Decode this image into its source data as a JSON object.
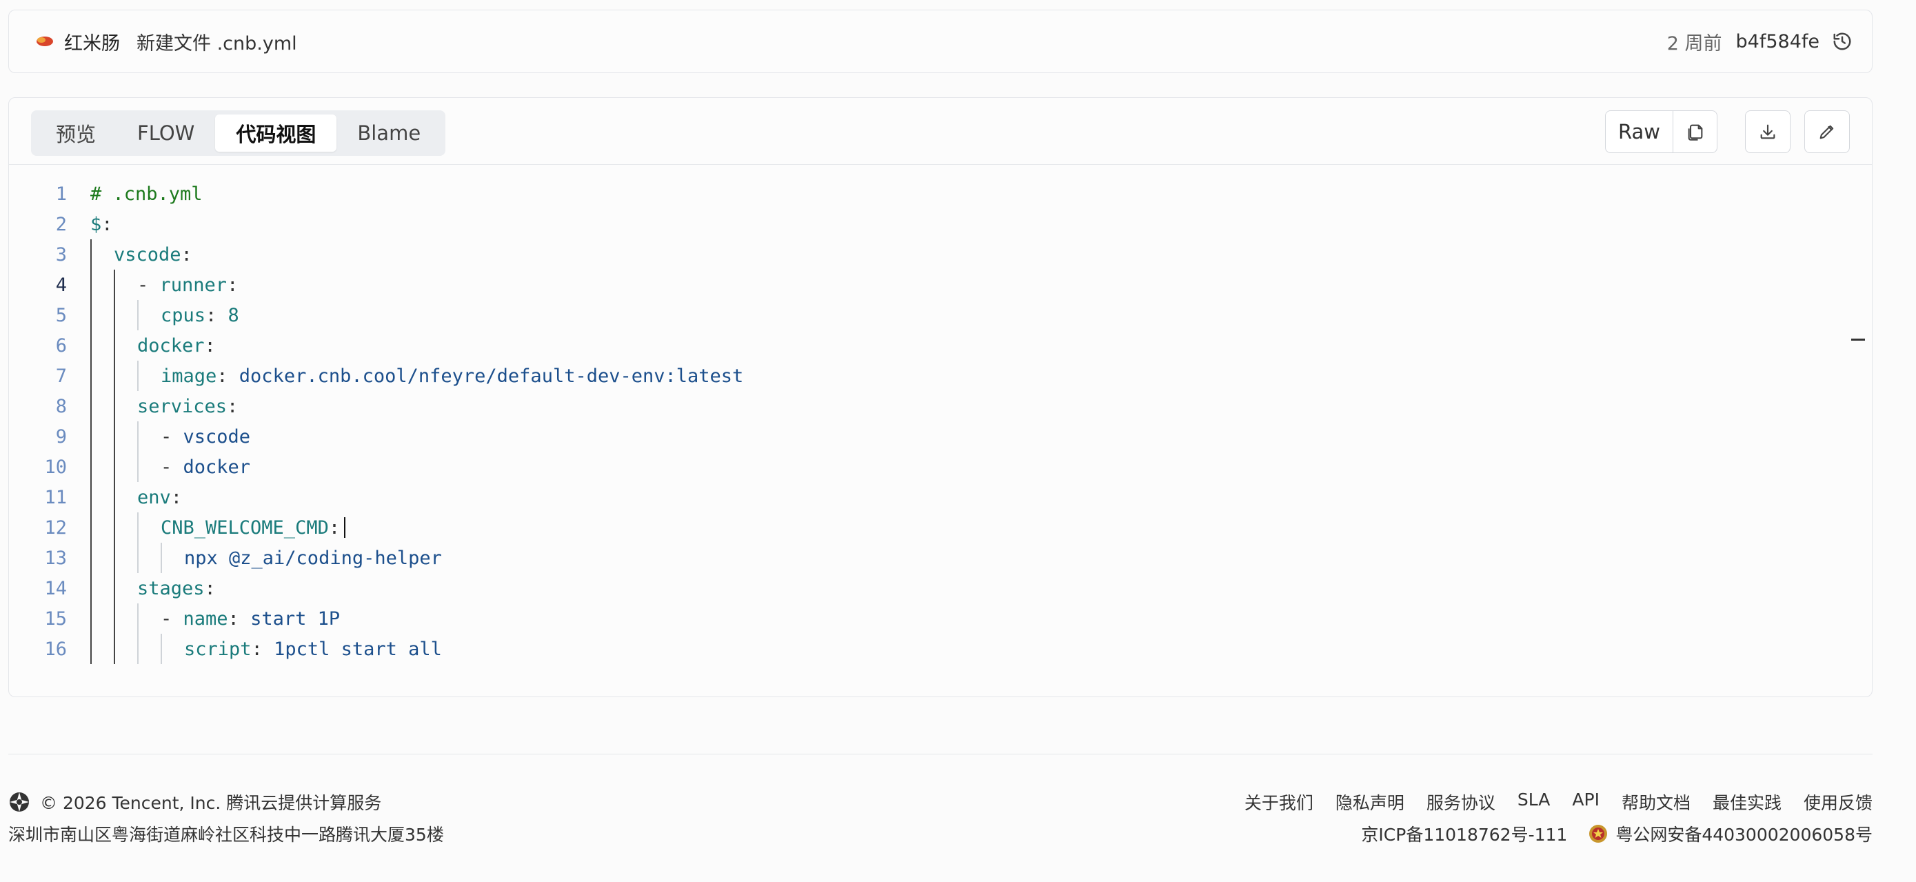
{
  "commit": {
    "author": "红米肠",
    "message_prefix": "新建文件",
    "message_file": ".cnb.yml",
    "time": "2 周前",
    "hash": "b4f584fe"
  },
  "tabs": [
    {
      "label": "预览",
      "active": false
    },
    {
      "label": "FLOW",
      "active": false
    },
    {
      "label": "代码视图",
      "active": true
    },
    {
      "label": "Blame",
      "active": false
    }
  ],
  "actions": {
    "raw_label": "Raw"
  },
  "code": {
    "current_line": 4,
    "lines": [
      {
        "n": "1",
        "tokens": [
          {
            "t": "# .cnb.yml",
            "c": "c-comment"
          }
        ]
      },
      {
        "n": "2",
        "tokens": [
          {
            "t": "$",
            "c": "c-key"
          },
          {
            "t": ":",
            "c": "c-punct"
          }
        ]
      },
      {
        "n": "3",
        "tokens": [
          {
            "t": "vscode",
            "c": "c-key"
          },
          {
            "t": ":",
            "c": "c-punct"
          }
        ]
      },
      {
        "n": "4",
        "tokens": [
          {
            "t": "- ",
            "c": "c-punct"
          },
          {
            "t": "runner",
            "c": "c-key"
          },
          {
            "t": ":",
            "c": "c-punct"
          }
        ]
      },
      {
        "n": "5",
        "tokens": [
          {
            "t": "cpus",
            "c": "c-key"
          },
          {
            "t": ": ",
            "c": "c-punct"
          },
          {
            "t": "8",
            "c": "c-num"
          }
        ]
      },
      {
        "n": "6",
        "tokens": [
          {
            "t": "docker",
            "c": "c-key"
          },
          {
            "t": ":",
            "c": "c-punct"
          }
        ]
      },
      {
        "n": "7",
        "tokens": [
          {
            "t": "image",
            "c": "c-key"
          },
          {
            "t": ": ",
            "c": "c-punct"
          },
          {
            "t": "docker.cnb.cool/nfeyre/default-dev-env:latest",
            "c": "c-str"
          }
        ]
      },
      {
        "n": "8",
        "tokens": [
          {
            "t": "services",
            "c": "c-key"
          },
          {
            "t": ":",
            "c": "c-punct"
          }
        ]
      },
      {
        "n": "9",
        "tokens": [
          {
            "t": "- ",
            "c": "c-punct"
          },
          {
            "t": "vscode",
            "c": "c-str"
          }
        ]
      },
      {
        "n": "10",
        "tokens": [
          {
            "t": "- ",
            "c": "c-punct"
          },
          {
            "t": "docker",
            "c": "c-str"
          }
        ]
      },
      {
        "n": "11",
        "tokens": [
          {
            "t": "env",
            "c": "c-key"
          },
          {
            "t": ":",
            "c": "c-punct"
          }
        ]
      },
      {
        "n": "12",
        "tokens": [
          {
            "t": "CNB_WELCOME_CMD",
            "c": "c-key"
          },
          {
            "t": ":",
            "c": "c-punct"
          }
        ]
      },
      {
        "n": "13",
        "tokens": [
          {
            "t": "npx @z_ai/coding-helper",
            "c": "c-str"
          }
        ]
      },
      {
        "n": "14",
        "tokens": [
          {
            "t": "stages",
            "c": "c-key"
          },
          {
            "t": ":",
            "c": "c-punct"
          }
        ]
      },
      {
        "n": "15",
        "tokens": [
          {
            "t": "- ",
            "c": "c-punct"
          },
          {
            "t": "name",
            "c": "c-key"
          },
          {
            "t": ": ",
            "c": "c-punct"
          },
          {
            "t": "start 1P",
            "c": "c-str"
          }
        ]
      },
      {
        "n": "16",
        "tokens": [
          {
            "t": "script",
            "c": "c-key"
          },
          {
            "t": ": ",
            "c": "c-punct"
          },
          {
            "t": "1pctl start all",
            "c": "c-str"
          }
        ]
      }
    ]
  },
  "footer": {
    "copyright": "© 2026 Tencent, Inc. 腾讯云提供计算服务",
    "address": "深圳市南山区粤海街道麻岭社区科技中一路腾讯大厦35楼",
    "links": [
      "关于我们",
      "隐私声明",
      "服务协议",
      "SLA",
      "API",
      "帮助文档",
      "最佳实践",
      "使用反馈"
    ],
    "icp": "京ICP备11018762号-111",
    "police": "粤公网安备44030002006058号"
  },
  "icons": {
    "history": "history-icon",
    "copy": "copy-icon",
    "download": "download-icon",
    "edit": "pencil-icon"
  }
}
